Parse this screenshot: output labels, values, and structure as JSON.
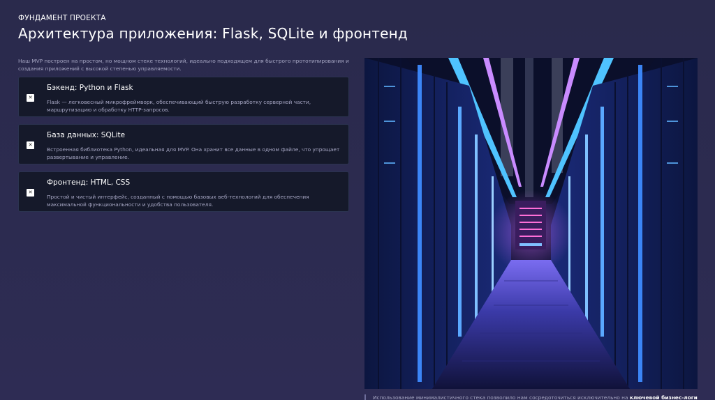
{
  "header": {
    "eyebrow": "ФУНДАМЕНТ ПРОЕКТА",
    "title": "Архитектура приложения: Flask, SQLite и фронтенд"
  },
  "intro": "Наш MVP построен на простом, но мощном стеке технологий, идеально подходящем для быстрого прототипирования и создания приложений с высокой степенью управляемости.",
  "cards": [
    {
      "title": "Бэкенд: Python и Flask",
      "text": "Flask — легковесный микрофреймворк, обеспечивающий быструю разработку серверной части, маршрутизацию и обработку HTTP-запросов.",
      "icon": "checkbox-icon"
    },
    {
      "title": "База данных: SQLite",
      "text": "Встроенная библиотека Python, идеальная для MVP. Она хранит все данные в одном файле, что упрощает развертывание и управление.",
      "icon": "checkbox-icon"
    },
    {
      "title": "Фронтенд: HTML, CSS",
      "text": "Простой и чистый интерфейс, созданный с помощью базовых веб-технологий для обеспечения максимальной функциональности и удобства пользователя.",
      "icon": "checkbox-icon"
    }
  ],
  "caption": {
    "text": "Использование минималистичного стека позволило нам сосредоточиться исключительно на",
    "bold": "ключевой бизнес-логике"
  },
  "colors": {
    "background": "#2a2a4c",
    "card": "#15192a",
    "accent_blue": "#3f8cff",
    "accent_purple": "#b06bff"
  }
}
